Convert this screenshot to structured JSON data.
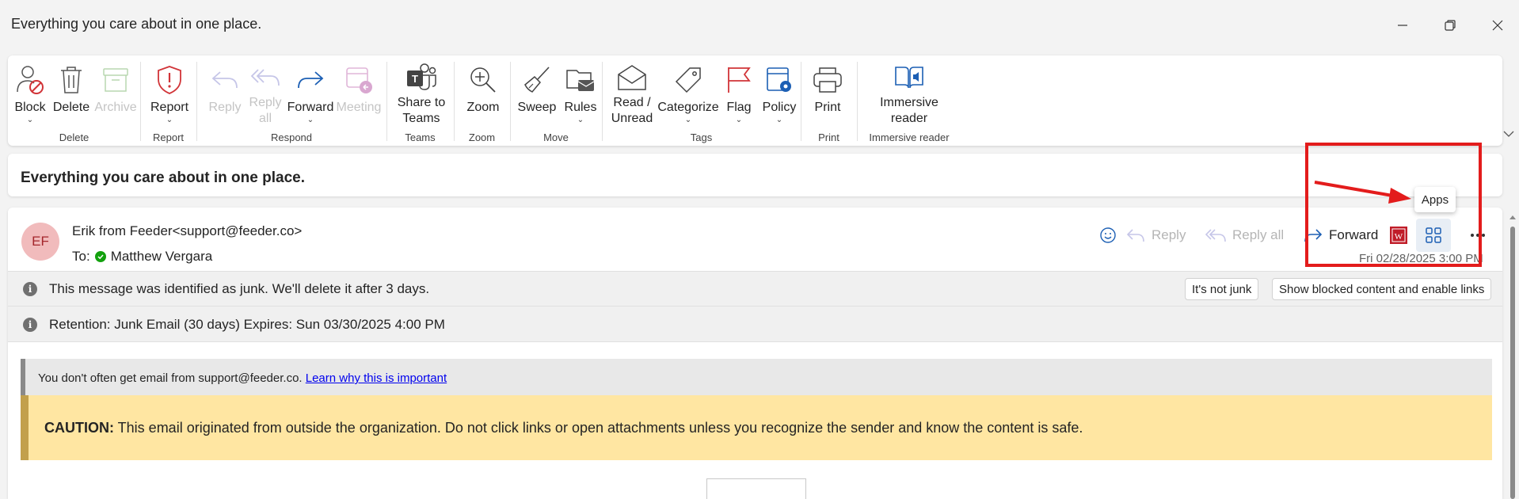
{
  "window": {
    "title": "Everything you care about in one place.",
    "controls": [
      "minimize-icon",
      "restore-icon",
      "close-icon"
    ]
  },
  "ribbon": {
    "buttons": [
      {
        "id": "block",
        "label": "Block",
        "has_dropdown": true,
        "disabled": false,
        "icon": "block-icon"
      },
      {
        "id": "delete",
        "label": "Delete",
        "has_dropdown": false,
        "disabled": false,
        "icon": "trash-icon"
      },
      {
        "id": "archive",
        "label": "Archive",
        "has_dropdown": false,
        "disabled": true,
        "icon": "archive-icon"
      },
      {
        "id": "report",
        "label": "Report",
        "has_dropdown": true,
        "disabled": false,
        "icon": "shield-alert-icon"
      },
      {
        "id": "reply",
        "label": "Reply",
        "has_dropdown": false,
        "disabled": true,
        "icon": "reply-icon"
      },
      {
        "id": "reply_all",
        "label": "Reply\nall",
        "has_dropdown": false,
        "disabled": true,
        "icon": "reply-all-icon"
      },
      {
        "id": "forward",
        "label": "Forward",
        "has_dropdown": true,
        "disabled": false,
        "icon": "forward-icon"
      },
      {
        "id": "meeting",
        "label": "Meeting",
        "has_dropdown": false,
        "disabled": true,
        "icon": "calendar-reply-icon"
      },
      {
        "id": "share_teams",
        "label": "Share to\nTeams",
        "has_dropdown": false,
        "disabled": false,
        "icon": "teams-icon"
      },
      {
        "id": "zoom",
        "label": "Zoom",
        "has_dropdown": false,
        "disabled": false,
        "icon": "zoom-icon"
      },
      {
        "id": "sweep",
        "label": "Sweep",
        "has_dropdown": false,
        "disabled": false,
        "icon": "broom-icon"
      },
      {
        "id": "rules",
        "label": "Rules",
        "has_dropdown": true,
        "disabled": false,
        "icon": "rules-icon"
      },
      {
        "id": "read_unread",
        "label": "Read /\nUnread",
        "has_dropdown": false,
        "disabled": false,
        "icon": "envelope-open-icon"
      },
      {
        "id": "categorize",
        "label": "Categorize",
        "has_dropdown": true,
        "disabled": false,
        "icon": "tag-icon"
      },
      {
        "id": "flag",
        "label": "Flag",
        "has_dropdown": true,
        "disabled": false,
        "icon": "flag-icon"
      },
      {
        "id": "policy",
        "label": "Policy",
        "has_dropdown": true,
        "disabled": false,
        "icon": "policy-icon"
      },
      {
        "id": "print",
        "label": "Print",
        "has_dropdown": false,
        "disabled": false,
        "icon": "printer-icon"
      },
      {
        "id": "immersive_reader",
        "label": "Immersive\nreader",
        "has_dropdown": false,
        "disabled": false,
        "icon": "immersive-reader-icon"
      }
    ],
    "groups": [
      "Delete",
      "Report",
      "Respond",
      "Teams",
      "Zoom",
      "Move",
      "Tags",
      "Print",
      "Immersive reader"
    ]
  },
  "subject": "Everything you care about in one place.",
  "message": {
    "avatar_initials": "EF",
    "sender": "Erik from Feeder<support@feeder.co>",
    "to_label": "To:",
    "recipient": "Matthew Vergara",
    "date": "Fri 02/28/2025 3:00 PM",
    "actions": {
      "emoji_icon": "emoji-icon",
      "reply": "Reply",
      "reply_all": "Reply all",
      "forward": "Forward",
      "apps_tooltip": "Apps"
    },
    "junk_notice": "This message was identified as junk. We'll delete it after 3 days.",
    "not_junk_button": "It's not junk",
    "show_blocked_button": "Show blocked content and enable links",
    "retention": "Retention: Junk Email (30 days) Expires: Sun 03/30/2025 4:00 PM",
    "first_contact_text": "You don't often get email from support@feeder.co. ",
    "first_contact_link": "Learn why this is important",
    "caution_label": "CAUTION:",
    "caution_text": " This email originated from outside the organization. Do not click links or open attachments unless you recognize the sender and know the content is safe."
  },
  "colors": {
    "accent": "#0f6cbd",
    "annotation_red": "#e31c1c",
    "caution_bg": "#ffe6a2",
    "avatar_bg": "#f1bbbc"
  }
}
